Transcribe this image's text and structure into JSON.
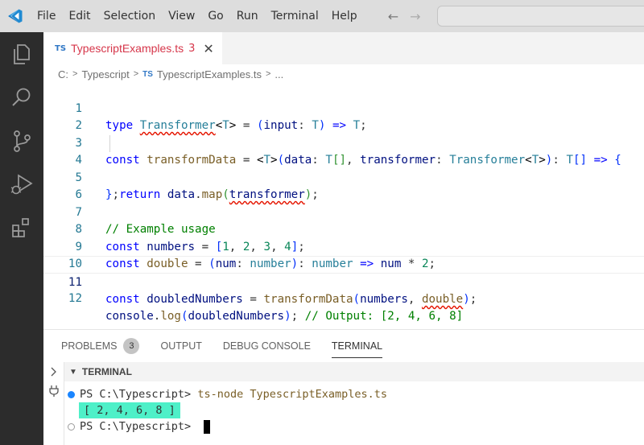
{
  "menu": {
    "items": [
      "File",
      "Edit",
      "Selection",
      "View",
      "Go",
      "Run",
      "Terminal",
      "Help"
    ]
  },
  "nav": {
    "back": "←",
    "forward": "→"
  },
  "activity": {
    "icons": [
      "explorer-icon",
      "search-icon",
      "source-control-icon",
      "run-debug-icon",
      "extensions-icon"
    ]
  },
  "tab": {
    "badge": "TS",
    "name": "TypescriptExamples.ts",
    "problems": "3",
    "close": "✕"
  },
  "breadcrumb": {
    "drive": "C:",
    "folder": "Typescript",
    "badge": "TS",
    "file": "TypescriptExamples.ts",
    "more": "..."
  },
  "code": {
    "line_numbers": [
      "1",
      "2",
      "3",
      "4",
      "5",
      "6",
      "7",
      "8",
      "9",
      "10",
      "11",
      "12"
    ],
    "lines": [
      "type Transformer<T> = (input: T) => T;",
      "",
      "const transformData = <T>(data: T[], transformer: Transformer<T>): T[] => {",
      "  return data.map(transformer);",
      "};",
      "",
      "// Example usage",
      "const numbers = [1, 2, 3, 4];",
      "const double = (num: number): number => num * 2;",
      "",
      "const doubledNumbers = transformData(numbers, double);",
      "console.log(doubledNumbers); // Output: [2, 4, 6, 8]"
    ]
  },
  "panel": {
    "tabs": [
      "PROBLEMS",
      "OUTPUT",
      "DEBUG CONSOLE",
      "TERMINAL"
    ],
    "problems_count": "3",
    "active_tab": "TERMINAL",
    "terminal_header": "TERMINAL",
    "prompt1": "PS C:\\Typescript> ",
    "command": "ts-node TypescriptExamples.ts",
    "output": "[ 2, 4, 6, 8 ]",
    "prompt2": "PS C:\\Typescript> "
  },
  "colors": {
    "accent": "#007acc",
    "error": "#e51400",
    "output_highlight": "#4ef0c8"
  }
}
